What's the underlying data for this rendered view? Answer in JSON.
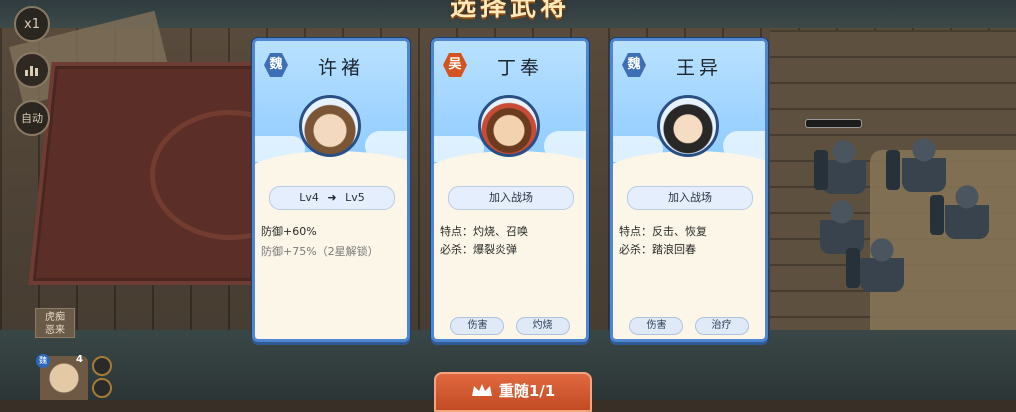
{
  "title": "选择武将",
  "hud": {
    "speed_label": "x1",
    "stats_icon": "bar-chart-icon",
    "auto_label": "自动"
  },
  "board_hero": {
    "tag": "虎痴\n恶来",
    "badge": "魏",
    "level": "4"
  },
  "cards": [
    {
      "faction": "魏",
      "faction_color": "#3e6eb6",
      "name": "许褚",
      "action": {
        "from": "Lv4",
        "to": "Lv5"
      },
      "stats": [
        "防御+60%",
        "防御+75%（2星解锁）"
      ],
      "tags": []
    },
    {
      "faction": "吴",
      "faction_color": "#d4541f",
      "name": "丁奉",
      "action_label": "加入战场",
      "trait": "特点：灼烧、召唤",
      "ultimate": "必杀：爆裂炎弹",
      "tags": [
        "伤害",
        "灼烧"
      ]
    },
    {
      "faction": "魏",
      "faction_color": "#3e6eb6",
      "name": "王异",
      "action_label": "加入战场",
      "trait": "特点：反击、恢复",
      "ultimate": "必杀：踏浪回春",
      "tags": [
        "伤害",
        "治疗"
      ]
    }
  ],
  "reroll": {
    "label": "重随1/1",
    "icon": "crown-icon"
  }
}
